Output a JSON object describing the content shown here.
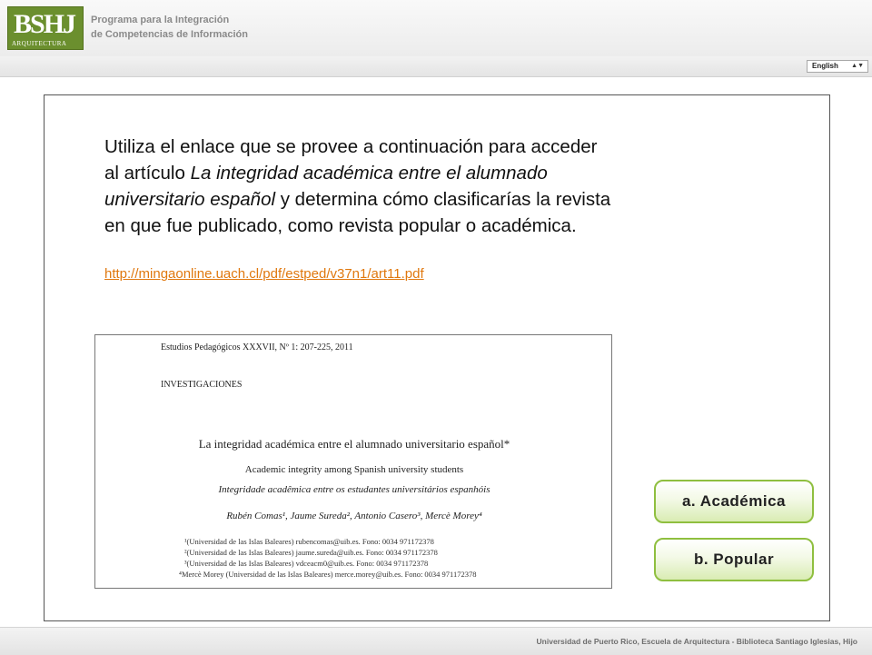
{
  "header": {
    "logo_letters": "BSHJ",
    "logo_sub": "ARQUITECTURA",
    "program_line1": "Programa para la Integración",
    "program_line2": "de Competencias de Información"
  },
  "language": {
    "selected": "English",
    "arrow": "▲▼"
  },
  "question": {
    "part1": "Utiliza el enlace que se provee a continuación para acceder al artículo ",
    "article_title": "La integridad académica entre el alumnado universitario español",
    "part2": " y determina cómo clasificarías la revista en que fue publicado, como revista popular o académica.",
    "link": "http://mingaonline.uach.cl/pdf/estped/v37n1/art11.pdf"
  },
  "article_image": {
    "journal": "Estudios Pedagógicos XXXVII, Nº 1: 207-225, 2011",
    "section": "INVESTIGACIONES",
    "title": "La integridad académica entre el alumnado universitario español*",
    "title_en": "Academic integrity among Spanish university students",
    "title_pt": "Integridade acadêmica entre os estudantes universitários espanhóis",
    "authors": "Rubén Comas¹, Jaume Sureda², Antonio Casero³, Mercè Morey⁴",
    "affiliations": [
      "¹(Universidad de las Islas Baleares) rubencomas@uib.es. Fono: 0034 971172378",
      "²(Universidad de las Islas Baleares) jaume.sureda@uib.es. Fono: 0034 971172378",
      "³(Universidad de las Islas Baleares) vdceacm0@uib.es. Fono: 0034 971172378",
      "⁴Mercè Morey (Universidad de las Islas Baleares) merce.morey@uib.es. Fono: 0034 971172378"
    ]
  },
  "answers": {
    "a": "a. Académica",
    "b": "b. Popular"
  },
  "footer": {
    "text": "Universidad de Puerto Rico, Escuela de Arquitectura - Biblioteca Santiago Iglesias, Hijo"
  }
}
